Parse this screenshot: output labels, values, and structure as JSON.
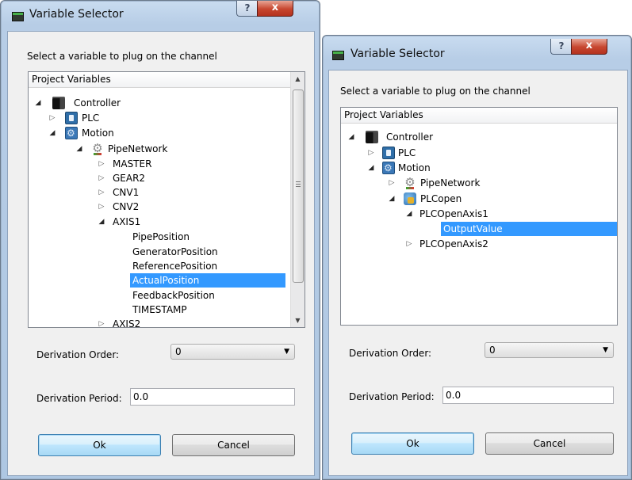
{
  "dialog1": {
    "title": "Variable Selector",
    "help_label": "?",
    "close_label": "x",
    "prompt": "Select a variable to plug on the channel",
    "tree_header": "Project Variables",
    "tree": {
      "controller": "Controller",
      "plc": "PLC",
      "motion": "Motion",
      "pipenetwork": "PipeNetwork",
      "master": "MASTER",
      "gear2": "GEAR2",
      "cnv1": "CNV1",
      "cnv2": "CNV2",
      "axis1": "AXIS1",
      "pipeposition": "PipePosition",
      "generatorposition": "GeneratorPosition",
      "referenceposition": "ReferencePosition",
      "actualposition": "ActualPosition",
      "feedbackposition": "FeedbackPosition",
      "timestamp": "TIMESTAMP",
      "axis2": "AXIS2"
    },
    "derivation_order_label": "Derivation Order:",
    "derivation_order_value": "0",
    "derivation_period_label": "Derivation Period:",
    "derivation_period_value": "0.0",
    "ok_label": "Ok",
    "cancel_label": "Cancel"
  },
  "dialog2": {
    "title": "Variable Selector",
    "help_label": "?",
    "close_label": "x",
    "prompt": "Select a variable to plug on the channel",
    "tree_header": "Project Variables",
    "tree": {
      "controller": "Controller",
      "plc": "PLC",
      "motion": "Motion",
      "pipenetwork": "PipeNetwork",
      "plcopen": "PLCopen",
      "plcopenaxis1": "PLCOpenAxis1",
      "outputvalue": "OutputValue",
      "plcopenaxis2": "PLCOpenAxis2"
    },
    "derivation_order_label": "Derivation Order:",
    "derivation_order_value": "0",
    "derivation_period_label": "Derivation Period:",
    "derivation_period_value": "0.0",
    "ok_label": "Ok",
    "cancel_label": "Cancel"
  },
  "colors": {
    "selection": "#3399ff",
    "window_frame": "#b7cde6",
    "close_button": "#c7462f"
  },
  "icons": {
    "controller": "controller-icon",
    "plc": "plc-icon",
    "motion": "motion-icon",
    "pipenetwork": "pipenetwork-icon",
    "plcopen": "plcopen-icon",
    "expanded": "triangle-down",
    "collapsed": "triangle-right"
  }
}
